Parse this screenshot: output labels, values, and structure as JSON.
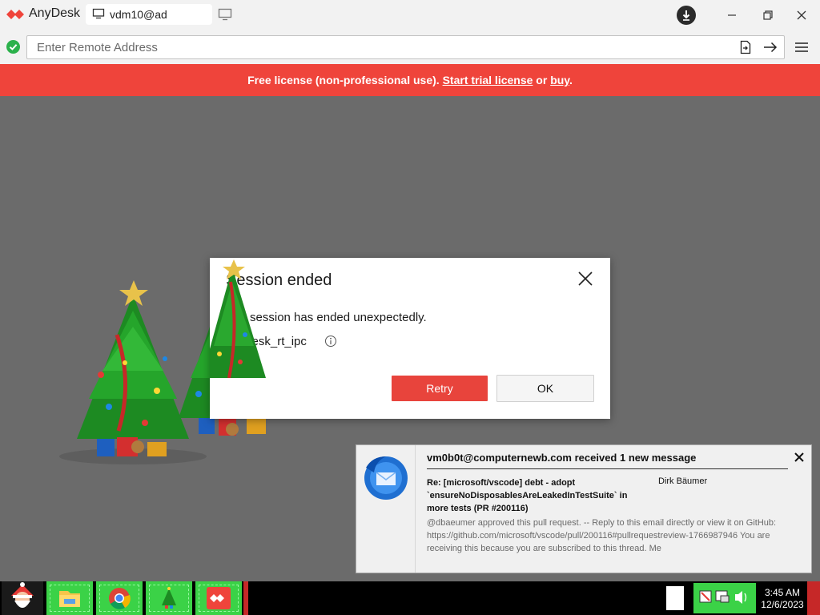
{
  "app": {
    "name": "AnyDesk",
    "tab_label": "vdm10@ad",
    "icons": [
      "anydesk-logo-icon",
      "monitor-icon",
      "new-tab-icon",
      "download-icon",
      "minimize-icon",
      "maximize-icon",
      "close-icon"
    ]
  },
  "address_bar": {
    "placeholder": "Enter Remote Address",
    "value": "",
    "icons": [
      "status-ok-icon",
      "file-transfer-icon",
      "arrow-right-icon",
      "hamburger-menu-icon"
    ]
  },
  "banner": {
    "text_prefix": "Free license (non-professional use).",
    "trial_link": "Start trial license",
    "or": "or",
    "buy_link": "buy",
    "suffix": ".",
    "color": "#ef443b"
  },
  "dialog": {
    "title": "Session ended",
    "message": "The session has ended unexpectedly.",
    "code": "anydesk_rt_ipc",
    "retry_label": "Retry",
    "ok_label": "OK",
    "accent_color": "#e8443c"
  },
  "notification": {
    "title": "vm0b0t@computernewb.com received 1 new message",
    "subject": "Re: [microsoft/vscode] debt - adopt `ensureNoDisposablesAreLeakedInTestSuite` in more tests (PR #200116)",
    "sender": "Dirk Bäumer",
    "body": "@dbaeumer approved this pull request. -- Reply to this email directly or view it on GitHub: https://github.com/microsoft/vscode/pull/200116#pullrequestreview-1766987946 You are receiving this because you are subscribed to this thread. Me"
  },
  "taskbar": {
    "apps": [
      "santa-start-icon",
      "file-explorer-icon",
      "chrome-icon",
      "christmas-tree-icon",
      "anydesk-icon"
    ],
    "time": "3:45 AM",
    "date": "12/6/2023"
  }
}
